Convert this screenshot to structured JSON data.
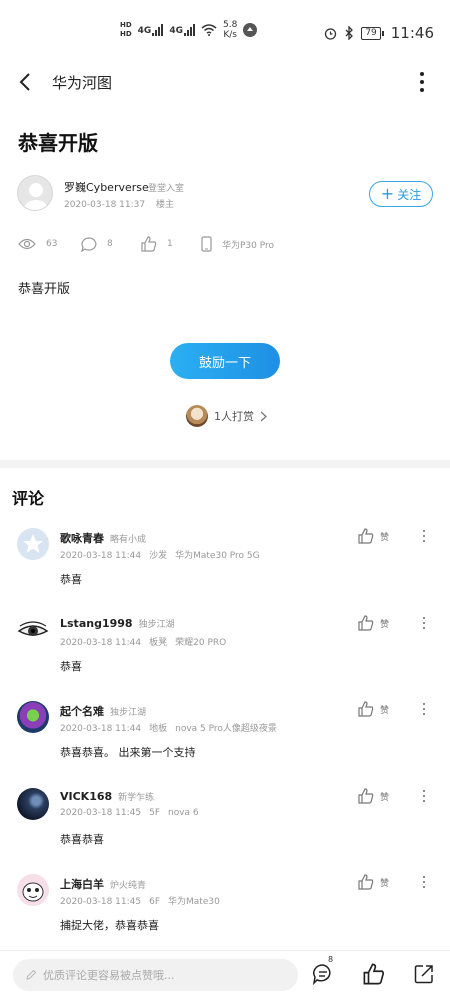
{
  "status_bar": {
    "net1": "4G",
    "net2": "4G",
    "speed_value": "5.8",
    "speed_unit": "K/s",
    "battery": "79",
    "time": "11:46"
  },
  "header": {
    "title": "华为河图"
  },
  "post": {
    "title": "恭喜开版",
    "author_name": "罗巍Cyberverse",
    "author_level": "登堂入室",
    "date": "2020-03-18 11:37",
    "role": "楼主",
    "follow_label": "关注",
    "views": "63",
    "comments": "8",
    "likes": "1",
    "device": "华为P30 Pro",
    "body": "恭喜开版",
    "encourage_label": "鼓励一下",
    "reward_text": "1人打赏"
  },
  "comments_section": {
    "title": "评论",
    "like_label": "赞",
    "items": [
      {
        "name": "歌咏青春",
        "level": "略有小成",
        "date": "2020-03-18 11:44",
        "floor": "沙发",
        "device": "华为Mate30 Pro 5G",
        "text": "恭喜"
      },
      {
        "name": "Lstang1998",
        "level": "独步江湖",
        "date": "2020-03-18 11:44",
        "floor": "板凳",
        "device": "荣耀20 PRO",
        "text": "恭喜"
      },
      {
        "name": "起个名难",
        "level": "独步江湖",
        "date": "2020-03-18 11:44",
        "floor": "地板",
        "device": "nova 5 Pro人像超级夜景",
        "text": "恭喜恭喜。 出来第一个支持"
      },
      {
        "name": "VICK168",
        "level": "新学乍练",
        "date": "2020-03-18 11:45",
        "floor": "5F",
        "device": "nova 6",
        "text": "恭喜恭喜"
      },
      {
        "name": "上海白羊",
        "level": "炉火纯青",
        "date": "2020-03-18 11:45",
        "floor": "6F",
        "device": "华为Mate30",
        "text": "捕捉大佬，恭喜恭喜"
      }
    ]
  },
  "bottom_bar": {
    "input_placeholder": "优质评论更容易被点赞哦...",
    "comment_count": "8"
  },
  "colors": {
    "accent": "#2a9ae3",
    "button_gradient_start": "#2ab0f2",
    "button_gradient_end": "#1f8fe4"
  }
}
